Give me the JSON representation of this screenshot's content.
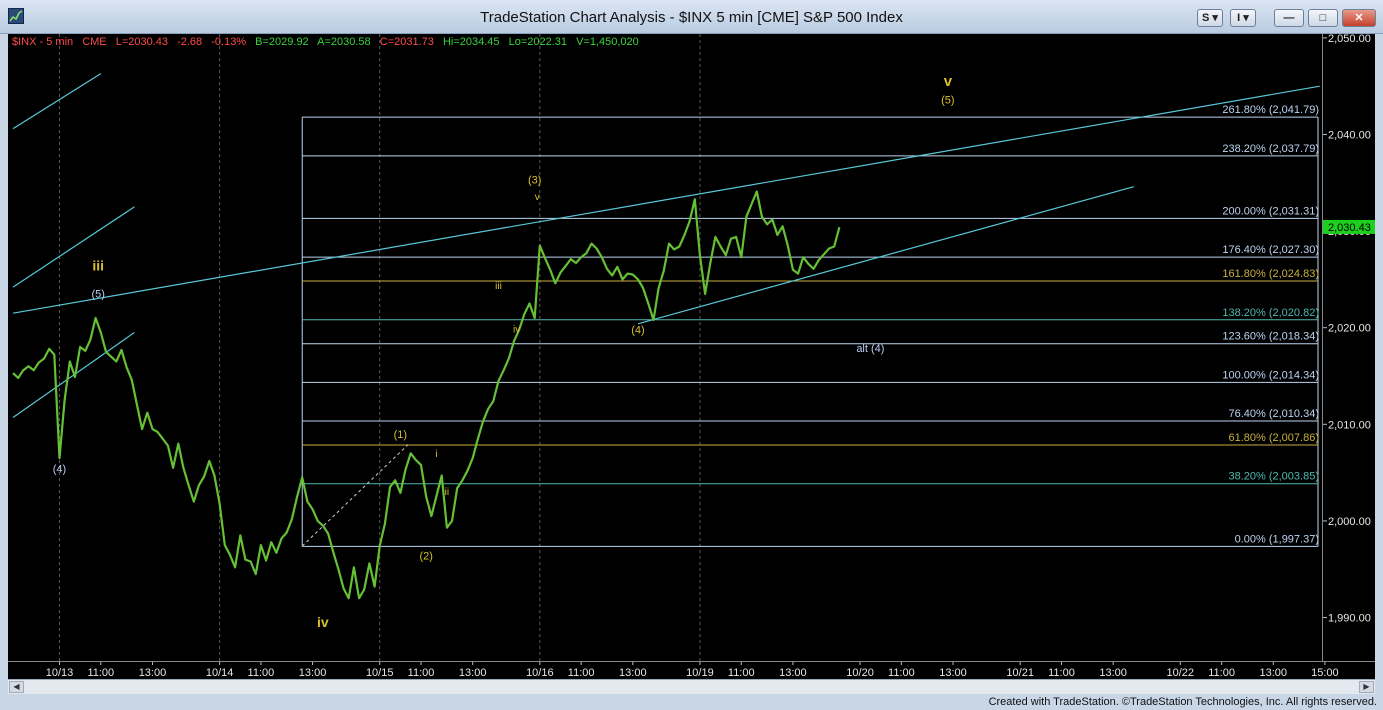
{
  "window": {
    "title": "TradeStation Chart Analysis - $INX 5 min [CME] S&P 500 Index",
    "sym_btn": "S",
    "ind_btn": "I",
    "minimize": "—",
    "maximize": "□",
    "close": "✕"
  },
  "info_bar": {
    "symbol": "$INX - 5 min",
    "exchange": "CME",
    "last": "L=2030.43",
    "change": "-2.68",
    "pct": "-0.13%",
    "bid": "B=2029.92",
    "ask": "A=2030.58",
    "close": "C=2031.73",
    "high": "Hi=2034.45",
    "low": "Lo=2022.31",
    "volume": "V=1,450,020"
  },
  "colors": {
    "price": "#66c036",
    "yellow_text": "#d8c030",
    "fib_default": "#bcd4f0",
    "fib_gold": "#c8b040",
    "fib_teal": "#50b8b0",
    "trendline": "#58c8d8",
    "last_bg": "#1ed01e",
    "label_red": "#ff4a4a",
    "label_green": "#3ad23a"
  },
  "chart_data": {
    "type": "line",
    "title": "$INX 5 min [CME] S&P 500 Index",
    "xlabel": "",
    "ylabel": "",
    "ylim": [
      1985.5,
      2050.4
    ],
    "y_ticks": [
      "2,050.00",
      "2,040.00",
      "2,030.00",
      "2,020.00",
      "2,010.00",
      "2,000.00",
      "1,990.00"
    ],
    "y_tick_values": [
      2050,
      2040,
      2030,
      2020,
      2010,
      2000,
      1990
    ],
    "last_price": "2,030.43",
    "last_value": 2030.43,
    "x_ticks": [
      "10/13",
      "11:00",
      "13:00",
      "10/14",
      "11:00",
      "13:00",
      "10/15",
      "11:00",
      "13:00",
      "10/16",
      "11:00",
      "13:00",
      "10/19",
      "11:00",
      "13:00",
      "10/20",
      "11:00",
      "13:00",
      "10/21",
      "11:00",
      "13:00",
      "10/22",
      "11:00",
      "13:00",
      "15:00"
    ],
    "x_tick_index": [
      9,
      17,
      27,
      40,
      48,
      58,
      71,
      79,
      89,
      102,
      110,
      120,
      133,
      141,
      151,
      164,
      172,
      182,
      195,
      203,
      213,
      226,
      234,
      244,
      254
    ],
    "series": [
      {
        "values": [
          2015.3,
          2014.8,
          2015.6,
          2016.0,
          2015.6,
          2016.4,
          2016.8,
          2017.8,
          2017.2,
          2006.5,
          2012.5,
          2016.5,
          2014.9,
          2018.0,
          2017.6,
          2018.8,
          2021.0,
          2019.5,
          2017.5,
          2017.0,
          2016.5,
          2017.7,
          2015.9,
          2014.6,
          2012.0,
          2009.5,
          2011.2,
          2009.5,
          2009.2,
          2008.5,
          2007.8,
          2005.5,
          2008.0,
          2005.5,
          2003.7,
          2002.0,
          2003.7,
          2004.6,
          2006.2,
          2004.7,
          2001.8,
          1997.5,
          1996.5,
          1995.2,
          1998.5,
          1996.0,
          1995.8,
          1994.5,
          1997.5,
          1995.9,
          1997.8,
          1996.7,
          1998.2,
          1998.8,
          2000.2,
          2002.5,
          2004.5,
          2002.0,
          2001.2,
          2000.0,
          1999.5,
          1998.7,
          1996.8,
          1995.0,
          1993.0,
          1992.0,
          1995.2,
          1992.0,
          1992.9,
          1995.6,
          1993.2,
          1997.4,
          1999.7,
          2003.5,
          2004.2,
          2002.9,
          2005.3,
          2007.0,
          2006.3,
          2005.8,
          2002.5,
          2000.5,
          2002.6,
          2004.7,
          1999.3,
          2000.0,
          2003.4,
          2004.2,
          2005.2,
          2006.5,
          2008.5,
          2010.3,
          2011.6,
          2012.4,
          2014.5,
          2015.6,
          2016.8,
          2018.6,
          2019.8,
          2021.4,
          2022.5,
          2021.0,
          2028.5,
          2027.2,
          2026.0,
          2024.6,
          2025.7,
          2026.4,
          2027.1,
          2026.7,
          2027.3,
          2027.7,
          2028.7,
          2028.2,
          2027.3,
          2026.1,
          2025.4,
          2026.3,
          2025.0,
          2025.6,
          2025.5,
          2025.0,
          2024.1,
          2022.5,
          2020.8,
          2024.1,
          2025.9,
          2028.7,
          2028.1,
          2028.4,
          2029.6,
          2031.0,
          2033.3,
          2027.5,
          2023.5,
          2026.7,
          2029.4,
          2028.4,
          2027.5,
          2029.2,
          2029.4,
          2027.3,
          2031.5,
          2032.8,
          2034.1,
          2031.5,
          2030.7,
          2031.2,
          2029.6,
          2030.5,
          2028.5,
          2026.0,
          2025.6,
          2027.3,
          2026.6,
          2026.1,
          2027.0,
          2027.6,
          2028.2,
          2028.4,
          2030.4
        ]
      }
    ]
  },
  "fib_levels": [
    {
      "label": "261.80% (2,041.79)",
      "value": 2041.79,
      "style": "default"
    },
    {
      "label": "238.20% (2,037.79)",
      "value": 2037.79,
      "style": "default"
    },
    {
      "label": "200.00% (2,031.31)",
      "value": 2031.31,
      "style": "default"
    },
    {
      "label": "176.40% (2,027.30)",
      "value": 2027.3,
      "style": "default"
    },
    {
      "label": "161.80% (2,024.83)",
      "value": 2024.83,
      "style": "gold"
    },
    {
      "label": "138.20% (2,020.82)",
      "value": 2020.82,
      "style": "teal"
    },
    {
      "label": "123.60% (2,018.34)",
      "value": 2018.34,
      "style": "default"
    },
    {
      "label": "100.00% (2,014.34)",
      "value": 2014.34,
      "style": "default"
    },
    {
      "label": "76.40% (2,010.34)",
      "value": 2010.34,
      "style": "default"
    },
    {
      "label": "61.80% (2,007.86)",
      "value": 2007.86,
      "style": "gold"
    },
    {
      "label": "38.20% (2,003.85)",
      "value": 2003.85,
      "style": "teal"
    },
    {
      "label": "0.00% (1,997.37)",
      "value": 1997.37,
      "style": "default"
    }
  ],
  "wave_labels": [
    {
      "text": "(4)",
      "x": 9,
      "y": 2005.0,
      "color": "#b8ccf0",
      "size": 11
    },
    {
      "text": "(5)",
      "x": 16.5,
      "y": 2023.1,
      "color": "#b8ccf0",
      "size": 11
    },
    {
      "text": "iii",
      "x": 16.5,
      "y": 2025.9,
      "color": "#d8c030",
      "size": 14,
      "bold": true
    },
    {
      "text": "iv",
      "x": 60,
      "y": 1989.0,
      "color": "#d8c030",
      "size": 14,
      "bold": true
    },
    {
      "text": "(1)",
      "x": 75,
      "y": 2008.6,
      "color": "#d8c030",
      "size": 11
    },
    {
      "text": "(2)",
      "x": 80,
      "y": 1996.0,
      "color": "#d8c030",
      "size": 11
    },
    {
      "text": "i",
      "x": 82,
      "y": 2006.6,
      "color": "#d8c030",
      "size": 10
    },
    {
      "text": "ii",
      "x": 84,
      "y": 2002.7,
      "color": "#d8c030",
      "size": 10
    },
    {
      "text": "iii",
      "x": 94,
      "y": 2024.0,
      "color": "#d8c030",
      "size": 10
    },
    {
      "text": "iv",
      "x": 97.5,
      "y": 2019.5,
      "color": "#d8c030",
      "size": 10
    },
    {
      "text": "(3)",
      "x": 101,
      "y": 2034.9,
      "color": "#d8c030",
      "size": 11
    },
    {
      "text": "v",
      "x": 101.5,
      "y": 2033.2,
      "color": "#d8c030",
      "size": 10
    },
    {
      "text": "(4)",
      "x": 121,
      "y": 2019.4,
      "color": "#d8c030",
      "size": 11
    },
    {
      "text": "alt (4)",
      "x": 166,
      "y": 2017.5,
      "color": "#b8ccf0",
      "size": 11
    },
    {
      "text": "v",
      "x": 181,
      "y": 2045.0,
      "color": "#d8c030",
      "size": 15,
      "bold": true
    },
    {
      "text": "(5)",
      "x": 181,
      "y": 2043.2,
      "color": "#d8c030",
      "size": 11
    }
  ],
  "footer": {
    "credits": "Created with TradeStation. ©TradeStation Technologies, Inc. All rights reserved."
  }
}
